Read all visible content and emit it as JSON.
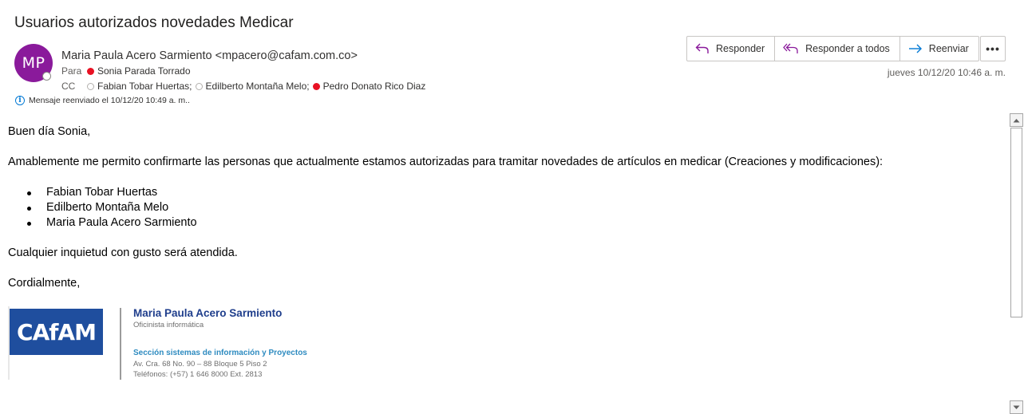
{
  "subject": "Usuarios autorizados novedades Medicar",
  "sender": {
    "initials": "MP",
    "avatar_color": "#8a1a9b",
    "display": "Maria Paula Acero Sarmiento <mpacero@cafam.com.co>"
  },
  "to": {
    "label": "Para",
    "recipients": [
      {
        "name": "Sonia Parada Torrado",
        "status": "busy"
      }
    ]
  },
  "cc": {
    "label": "CC",
    "recipients": [
      {
        "name": "Fabian Tobar Huertas;",
        "status": "unknown"
      },
      {
        "name": "Edilberto Montaña Melo;",
        "status": "unknown"
      },
      {
        "name": "Pedro Donato Rico Diaz",
        "status": "busy"
      }
    ]
  },
  "forward_info": "Mensaje reenviado el 10/12/20 10:49 a. m..",
  "actions": {
    "reply": "Responder",
    "reply_all": "Responder a todos",
    "forward": "Reenviar",
    "more": "•••"
  },
  "date": "jueves 10/12/20 10:46 a. m.",
  "colors": {
    "accent": "#0078d4",
    "reply_icon": "#8a1a9b",
    "forward_icon": "#0078d4",
    "presence_busy": "#e81123",
    "cafam_blue": "#1f4e9e",
    "sig_name_blue": "#1f3e8c",
    "sig_dept_blue": "#2e8bc0"
  },
  "body": {
    "greeting": "Buen día Sonia,",
    "intro": "Amablemente me permito confirmarte las personas que actualmente estamos autorizadas para tramitar novedades de artículos en medicar (Creaciones y modificaciones):",
    "list": [
      "Fabian Tobar Huertas",
      "Edilberto Montaña Melo",
      "Maria Paula Acero Sarmiento"
    ],
    "closing_line": "Cualquier inquietud con gusto será atendida.",
    "signoff": "Cordialmente,"
  },
  "signature": {
    "logo_text": "CAfAM",
    "name": "Maria Paula Acero Sarmiento",
    "role": "Oficinista informática",
    "department": "Sección sistemas de información y Proyectos",
    "address": "Av. Cra. 68 No. 90 – 88 Bloque 5 Piso 2",
    "phone": "Teléfonos: (+57) 1 646 8000 Ext. 2813"
  }
}
